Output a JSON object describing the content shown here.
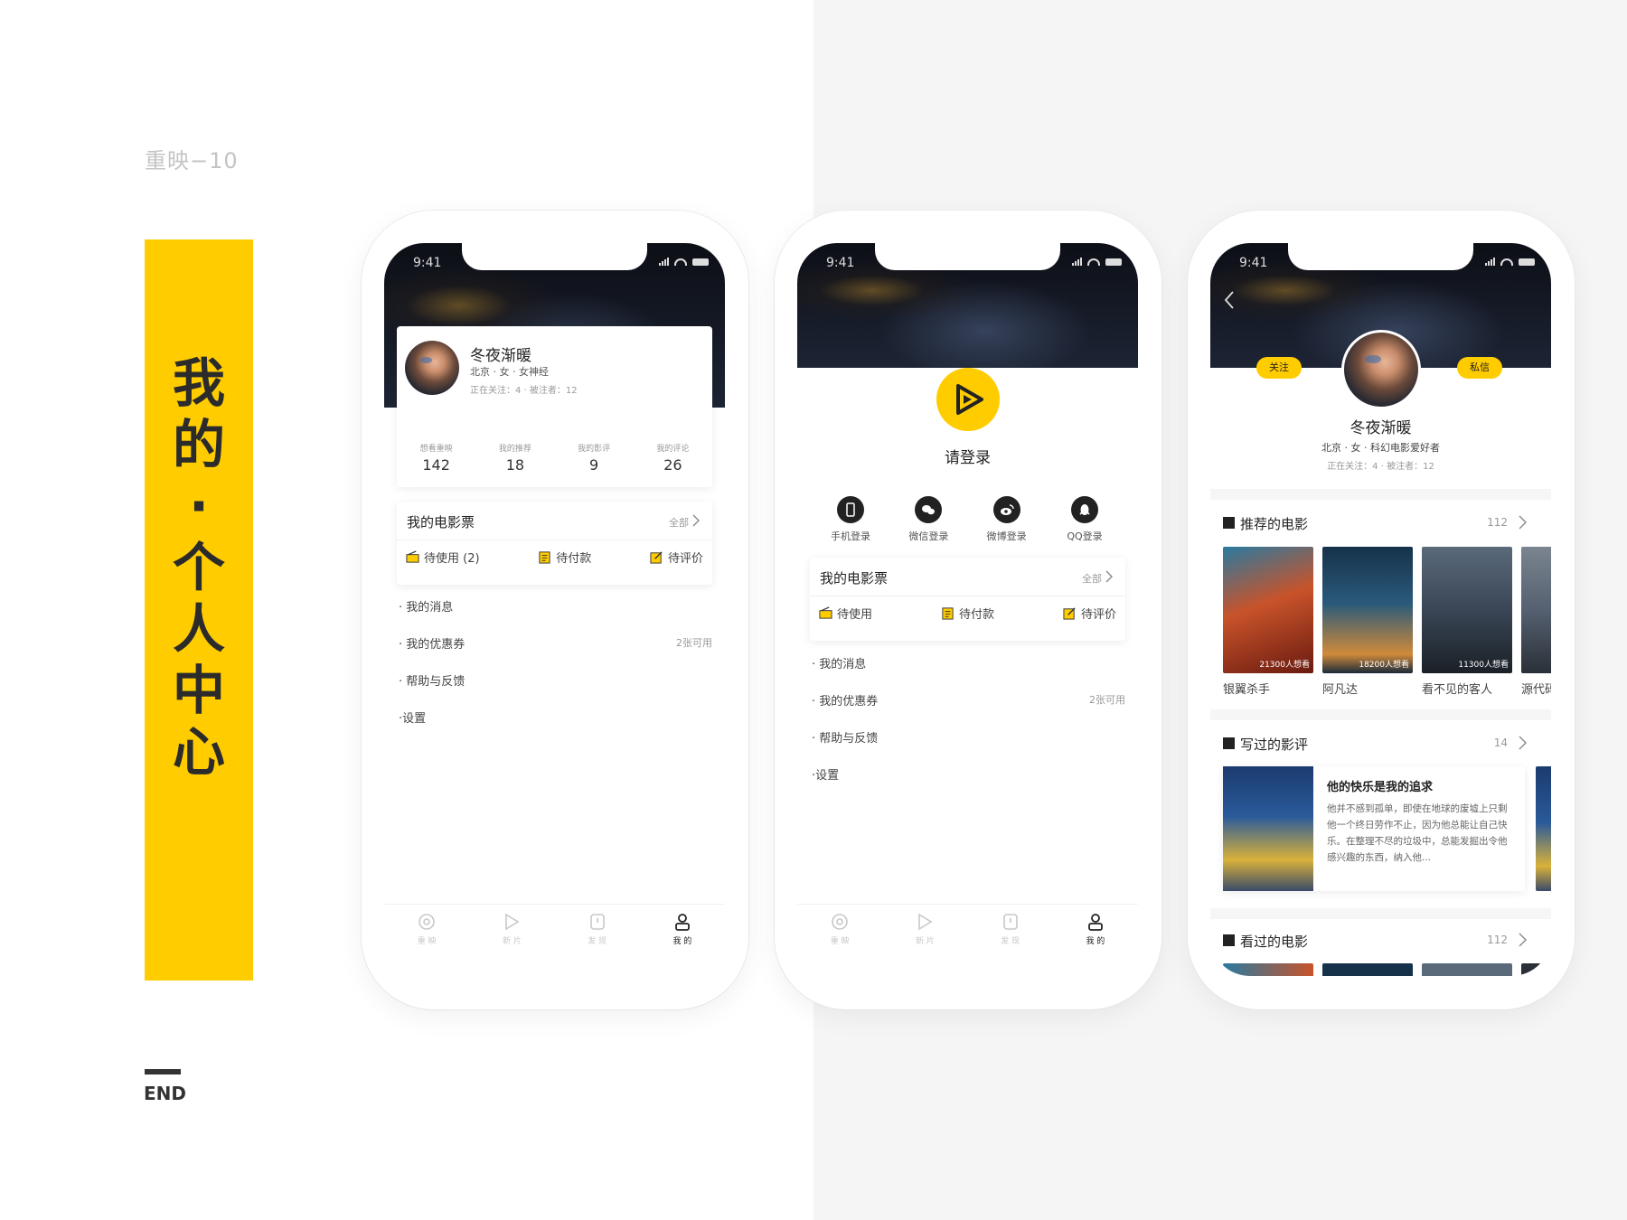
{
  "page": {
    "label": "重映−10",
    "title_chars": [
      "我",
      "的",
      "·",
      "个",
      "人",
      "中",
      "心"
    ],
    "end_label": "END",
    "accent_color": "#FFCC00"
  },
  "status_time": "9:41",
  "phone1": {
    "profile": {
      "name": "冬夜渐暖",
      "meta": "北京 · 女 · 女神经",
      "follow": "正在关注：4 · 被注者：12"
    },
    "stats": [
      {
        "label": "想看重映",
        "value": "142"
      },
      {
        "label": "我的推荐",
        "value": "18"
      },
      {
        "label": "我的影评",
        "value": "9"
      },
      {
        "label": "我的评论",
        "value": "26"
      }
    ],
    "tickets": {
      "title": "我的电影票",
      "all": "全部",
      "items": [
        {
          "icon": "ticket-icon",
          "label": "待使用 (2)"
        },
        {
          "icon": "clipboard-icon",
          "label": "待付款"
        },
        {
          "icon": "edit-icon",
          "label": "待评价"
        }
      ]
    },
    "menu": [
      {
        "label": "· 我的消息",
        "right": ""
      },
      {
        "label": "· 我的优惠券",
        "right": "2张可用"
      },
      {
        "label": "· 帮助与反馈",
        "right": ""
      },
      {
        "label": "·设置",
        "right": ""
      }
    ]
  },
  "phone2": {
    "login_title": "请登录",
    "login_options": [
      {
        "icon": "phone-icon",
        "label": "手机登录"
      },
      {
        "icon": "wechat-icon",
        "label": "微信登录"
      },
      {
        "icon": "weibo-icon",
        "label": "微博登录"
      },
      {
        "icon": "qq-icon",
        "label": "QQ登录"
      }
    ],
    "tickets": {
      "title": "我的电影票",
      "all": "全部",
      "items": [
        {
          "icon": "ticket-icon",
          "label": "待使用"
        },
        {
          "icon": "clipboard-icon",
          "label": "待付款"
        },
        {
          "icon": "edit-icon",
          "label": "待评价"
        }
      ]
    },
    "menu": [
      {
        "label": "· 我的消息",
        "right": ""
      },
      {
        "label": "· 我的优惠券",
        "right": "2张可用"
      },
      {
        "label": "· 帮助与反馈",
        "right": ""
      },
      {
        "label": "·设置",
        "right": ""
      }
    ]
  },
  "tabs": [
    {
      "icon": "film-reel-icon",
      "label": "重 映"
    },
    {
      "icon": "play-icon",
      "label": "新 片"
    },
    {
      "icon": "discover-icon",
      "label": "发 现"
    },
    {
      "icon": "user-icon",
      "label": "我 的"
    }
  ],
  "phone3": {
    "follow_btn": "关注",
    "message_btn": "私信",
    "name": "冬夜渐暖",
    "meta": "北京 · 女 · 科幻电影爱好者",
    "follow": "正在关注：4 · 被注者：12",
    "recommended": {
      "title": "推荐的电影",
      "count": "112",
      "movies": [
        {
          "title": "银翼杀手",
          "count": "21300人想看",
          "color": "#c8532a"
        },
        {
          "title": "阿凡达",
          "count": "18200人想看",
          "color": "#2a5a7a"
        },
        {
          "title": "看不见的客人",
          "count": "11300人想看",
          "color": "#3a4656"
        },
        {
          "title": "源代码",
          "count": "",
          "color": "#556070"
        }
      ]
    },
    "reviews": {
      "title": "写过的影评",
      "count": "14",
      "item": {
        "title": "他的快乐是我的追求",
        "text": "他并不感到孤单，即使在地球的废墟上只剩他一个终日劳作不止，因为他总能让自己快乐。在整理不尽的垃圾中，总能发掘出令他感兴趣的东西，纳入他..."
      }
    },
    "watched": {
      "title": "看过的电影",
      "count": "112"
    }
  }
}
